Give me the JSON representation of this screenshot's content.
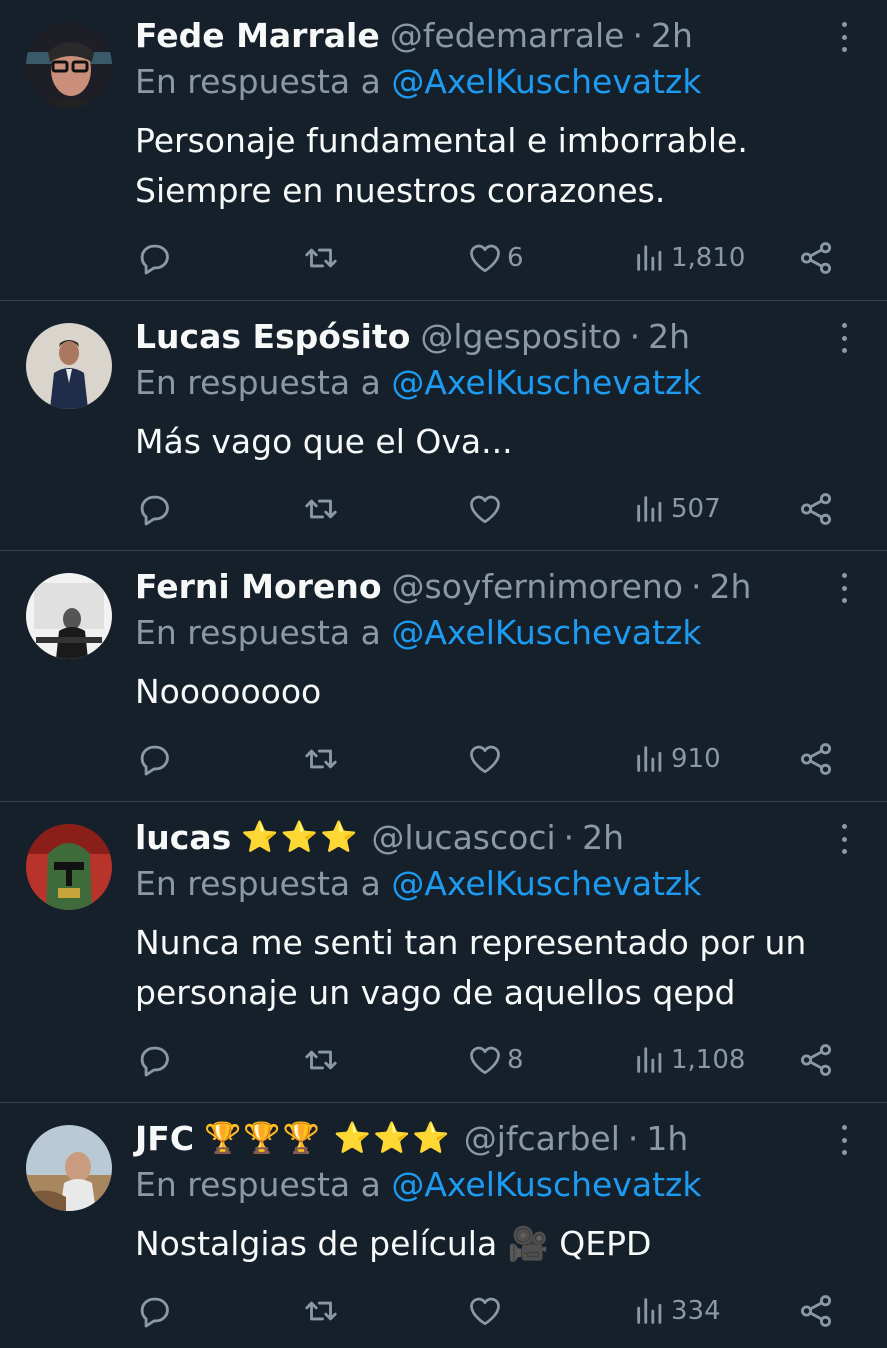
{
  "reply_prefix": "En respuesta a",
  "tweets": [
    {
      "name": "Fede Marrale",
      "badges": "",
      "handle": "@fedemarrale",
      "time": "2h",
      "reply_to": "@AxelKuschevatzk",
      "text": "Personaje fundamental e imborrable. Siempre en nuestros corazones.",
      "likes": "6",
      "views": "1,810",
      "avatar": "avatar-man-glasses"
    },
    {
      "name": "Lucas Espósito",
      "badges": "",
      "handle": "@lgesposito",
      "time": "2h",
      "reply_to": "@AxelKuschevatzk",
      "text": "Más vago que el Ova...",
      "likes": "",
      "views": "507",
      "avatar": "avatar-man-suit"
    },
    {
      "name": "Ferni Moreno",
      "badges": "",
      "handle": "@soyfernimoreno",
      "time": "2h",
      "reply_to": "@AxelKuschevatzk",
      "text": "Noooooooo",
      "likes": "",
      "views": "910",
      "avatar": "avatar-bw-photo"
    },
    {
      "name": "lucas",
      "badges": "⭐⭐⭐",
      "handle": "@lucascoci",
      "time": "2h",
      "reply_to": "@AxelKuschevatzk",
      "text": "Nunca me senti tan representado por un personaje un vago de aquellos qepd",
      "likes": "8",
      "views": "1,108",
      "avatar": "avatar-helmet"
    },
    {
      "name": "JFC",
      "badges": "🏆🏆🏆 ⭐⭐⭐",
      "handle": "@jfcarbel",
      "time": "1h",
      "reply_to": "@AxelKuschevatzk",
      "text": "Nostalgias de película 🎥 QEPD",
      "likes": "",
      "views": "334",
      "avatar": "avatar-landscape-selfie"
    }
  ],
  "colors": {
    "background": "#15202b",
    "divider": "#38444d",
    "secondary_text": "#8b98a5",
    "mention": "#1d9bf0"
  }
}
